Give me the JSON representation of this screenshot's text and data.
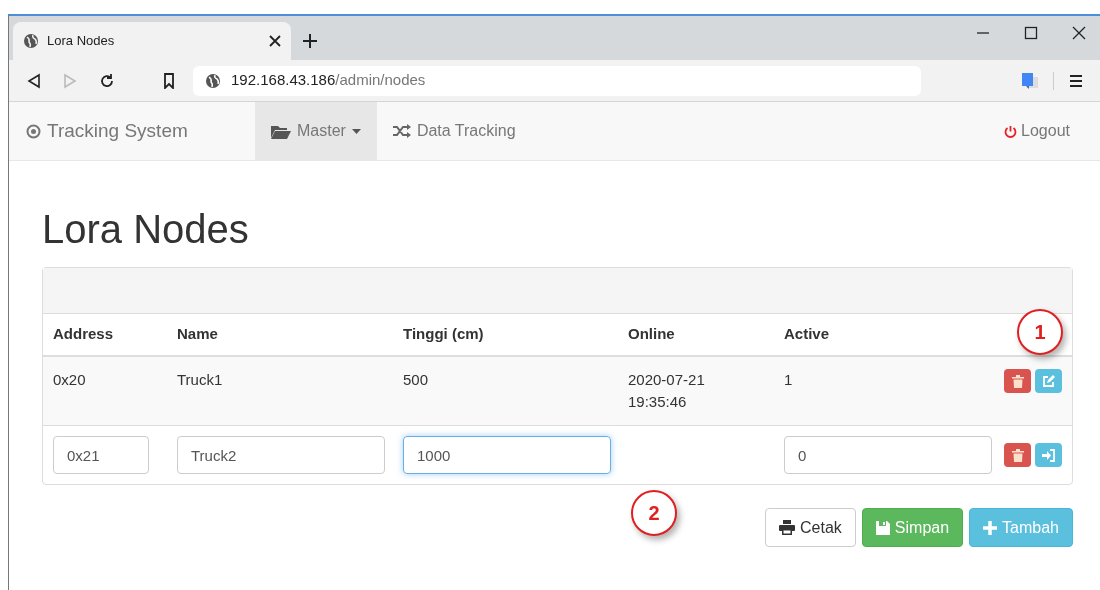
{
  "browser": {
    "tab_title": "Lora Nodes",
    "url_host": "192.168.43.186",
    "url_path": "/admin/nodes"
  },
  "navbar": {
    "brand": "Tracking System",
    "items": [
      {
        "label": "Master",
        "kind": "dropdown",
        "selected": true
      },
      {
        "label": "Data Tracking",
        "kind": "link",
        "selected": false
      }
    ],
    "logout": "Logout"
  },
  "page_title": "Lora Nodes",
  "table": {
    "columns": [
      "Address",
      "Name",
      "Tinggi (cm)",
      "Online",
      "Active"
    ],
    "rows": [
      {
        "kind": "static",
        "cells": [
          "0x20",
          "Truck1",
          "500",
          "2020-07-21\n19:35:46",
          "1"
        ]
      },
      {
        "kind": "edit",
        "cells": [
          {
            "value": "0x21",
            "focused": false
          },
          {
            "value": "Truck2",
            "focused": false
          },
          {
            "value": "1000",
            "focused": true
          },
          null,
          {
            "value": "0",
            "focused": false
          }
        ]
      }
    ]
  },
  "buttons": [
    {
      "label": "Cetak",
      "kind": "default"
    },
    {
      "label": "Simpan",
      "kind": "success"
    },
    {
      "label": "Tambah",
      "kind": "info"
    }
  ],
  "annotations": [
    "1",
    "2"
  ]
}
